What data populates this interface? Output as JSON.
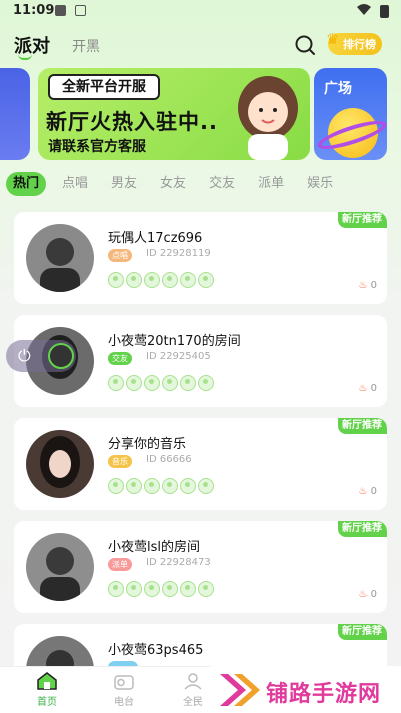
{
  "status_bar": {
    "time": "11:09"
  },
  "header": {
    "brand": "派对",
    "secondary_tab": "开黑",
    "rank_label": "排行榜"
  },
  "banner": {
    "tag": "全新平台开服",
    "title": "新厅火热入驻中..",
    "subtitle": "请联系官方客服",
    "side_label": "广场"
  },
  "categories": [
    "热门",
    "点唱",
    "男友",
    "女友",
    "交友",
    "派单",
    "娱乐"
  ],
  "active_category": "热门",
  "rooms": [
    {
      "badge": "新厅推荐",
      "title": "玩偶人17cz696",
      "tag": "点唱",
      "tag_color": "#f4b87c",
      "id": "ID 22928119",
      "heat": "0"
    },
    {
      "badge": "新厅推荐",
      "title": "小夜莺20tn170的房间",
      "tag": "交友",
      "tag_color": "#62d24a",
      "id": "ID 22925405",
      "heat": "0"
    },
    {
      "badge": "新厅推荐",
      "title": "分享你的音乐",
      "tag": "音乐",
      "tag_color": "#f6c34a",
      "id": "ID 66666",
      "heat": "0"
    },
    {
      "badge": "新厅推荐",
      "title": "小夜莺lsl的房间",
      "tag": "派单",
      "tag_color": "#f69a9a",
      "id": "ID 22928473",
      "heat": "0"
    },
    {
      "badge": "新厅推荐",
      "title": "小夜莺63ps465",
      "tag": "",
      "tag_color": "#7fd0f0",
      "id": "",
      "heat": ""
    }
  ],
  "bottom_nav": [
    {
      "label": "首页",
      "icon": "home-icon",
      "active": true
    },
    {
      "label": "电台",
      "icon": "radio-icon",
      "active": false
    },
    {
      "label": "全民",
      "icon": "people-icon",
      "active": false
    }
  ],
  "watermark": {
    "text": "铺路手游网"
  },
  "colors": {
    "accent": "#62d24a",
    "rank": "#f4c11d",
    "flame": "#ff5a3c",
    "watermark": "#e03a9c"
  }
}
